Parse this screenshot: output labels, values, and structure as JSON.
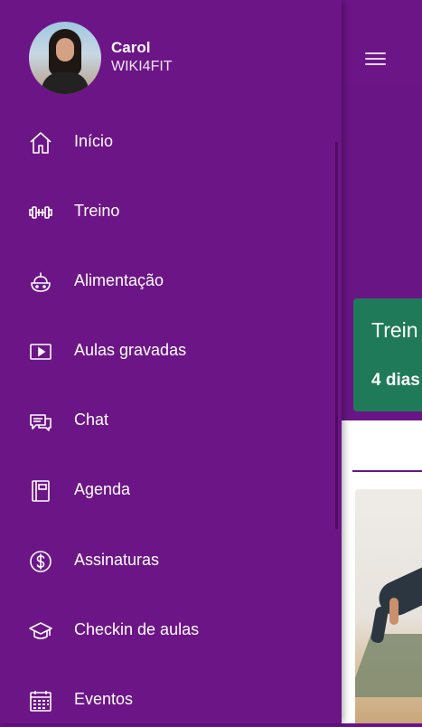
{
  "colors": {
    "drawer_bg": "#6c1587",
    "accent_card": "#1f7a5a",
    "text": "#ffffff"
  },
  "profile": {
    "name": "Carol",
    "organization": "WIKI4FIT"
  },
  "menu": [
    {
      "label": "Início",
      "icon": "home-icon"
    },
    {
      "label": "Treino",
      "icon": "dumbbell-icon"
    },
    {
      "label": "Alimentação",
      "icon": "food-icon"
    },
    {
      "label": "Aulas gravadas",
      "icon": "video-icon"
    },
    {
      "label": "Chat",
      "icon": "chat-icon"
    },
    {
      "label": "Agenda",
      "icon": "agenda-icon"
    },
    {
      "label": "Assinaturas",
      "icon": "dollar-icon"
    },
    {
      "label": "Checkin de aulas",
      "icon": "graduation-cap-icon"
    },
    {
      "label": "Eventos",
      "icon": "calendar-icon"
    }
  ],
  "background": {
    "card_title": "Trein",
    "card_subtitle": "4 dias"
  }
}
